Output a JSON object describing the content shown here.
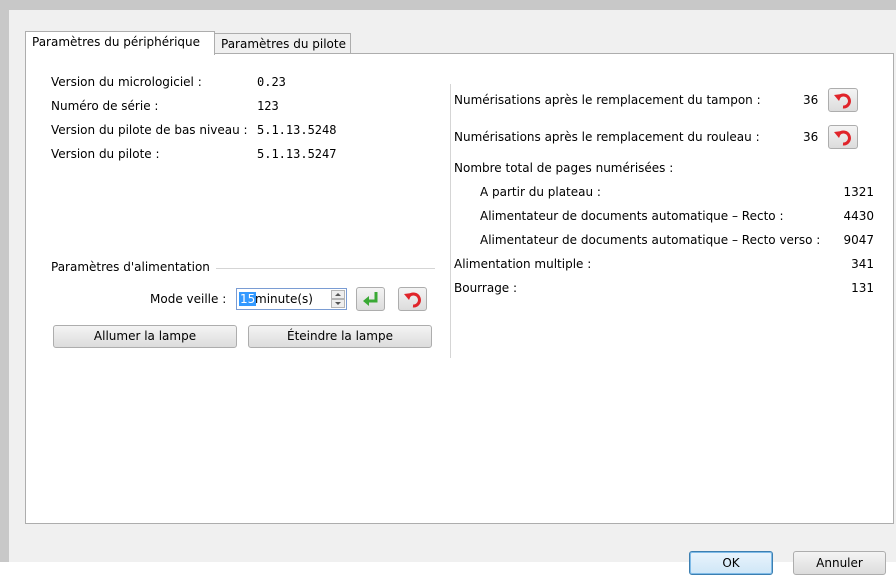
{
  "tabs": [
    {
      "label": "Paramètres du périphérique"
    },
    {
      "label": "Paramètres du pilote"
    }
  ],
  "device_info": {
    "firmware_label": "Version du micrologiciel :",
    "firmware_value": "0.23",
    "serial_label": "Numéro de série :",
    "serial_value": "123",
    "lowlevel_driver_label": "Version du pilote de bas niveau :",
    "lowlevel_driver_value": "5.1.13.5248",
    "driver_label": "Version du pilote :",
    "driver_value": "5.1.13.5247"
  },
  "power": {
    "group_label": "Paramètres d'alimentation",
    "sleep_label": "Mode veille :",
    "sleep_value": "15",
    "sleep_unit": "minute(s)",
    "lamp_on_label": "Allumer la lampe",
    "lamp_off_label": "Éteindre la lampe"
  },
  "counters": {
    "pad_label": "Numérisations après le remplacement du tampon :",
    "pad_value": "36",
    "roller_label": "Numérisations après le remplacement du rouleau :",
    "roller_value": "36",
    "total_label": "Nombre total de pages numérisées :",
    "flatbed_label": "A partir du plateau :",
    "flatbed_value": "1321",
    "adf_simplex_label": "Alimentateur de documents automatique – Recto :",
    "adf_simplex_value": "4430",
    "adf_duplex_label": "Alimentateur de documents automatique – Recto verso :",
    "adf_duplex_value": "9047",
    "multifeed_label": "Alimentation multiple :",
    "multifeed_value": "341",
    "jam_label": "Bourrage :",
    "jam_value": "131"
  },
  "footer": {
    "ok_label": "OK",
    "cancel_label": "Annuler"
  },
  "icons": {
    "reset": "undo-arrow-icon",
    "apply": "enter-arrow-icon"
  },
  "colors": {
    "reset_icon": "#e0242a",
    "apply_icon": "#3aa935",
    "selection": "#3399ff"
  }
}
